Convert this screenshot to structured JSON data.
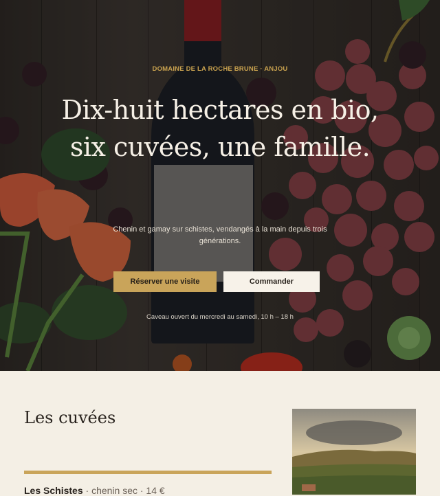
{
  "hero": {
    "eyebrow": "DOMAINE DE LA ROCHE BRUNE · ANJOU",
    "headline_line1": "Dix-huit hectares en bio,",
    "headline_line2": "six cuvées, une famille.",
    "subline": "Chenin et gamay sur schistes, vendangés à la main depuis trois générations.",
    "primary_button": "Réserver une visite",
    "secondary_button": "Commander",
    "hours": "Caveau ouvert du mercredi au samedi, 10 h – 18 h"
  },
  "cuvees": {
    "title": "Les cuvées",
    "items": [
      {
        "name": "Les Schistes",
        "separator": " · ",
        "meta": "chenin sec · 14 €"
      }
    ]
  },
  "colors": {
    "accent_gold": "#c9a45a",
    "cream_background": "#f4efe5",
    "dark_text": "#2a241f"
  }
}
